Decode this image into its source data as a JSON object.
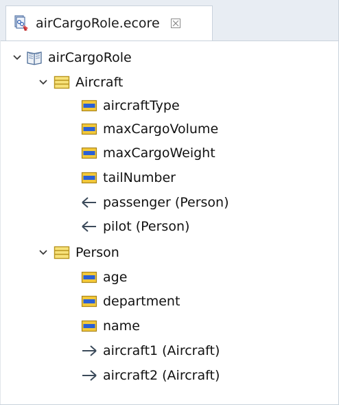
{
  "tab": {
    "title": "airCargoRole.ecore",
    "close_glyph": "⛝",
    "icon": "ecore-file-icon"
  },
  "tree": {
    "root": {
      "label": "airCargoRole",
      "icon": "package-icon",
      "expanded": true
    },
    "classes": [
      {
        "label": "Aircraft",
        "icon": "eclass-icon",
        "expanded": true,
        "children": [
          {
            "label": "aircraftType",
            "icon": "eattribute-icon"
          },
          {
            "label": "maxCargoVolume",
            "icon": "eattribute-icon"
          },
          {
            "label": "maxCargoWeight",
            "icon": "eattribute-icon"
          },
          {
            "label": "tailNumber",
            "icon": "eattribute-icon"
          },
          {
            "label": "passenger (Person)",
            "icon": "ereference-incoming-icon"
          },
          {
            "label": "pilot (Person)",
            "icon": "ereference-incoming-icon"
          }
        ]
      },
      {
        "label": "Person",
        "icon": "eclass-icon",
        "expanded": true,
        "children": [
          {
            "label": "age",
            "icon": "eattribute-icon"
          },
          {
            "label": "department",
            "icon": "eattribute-icon"
          },
          {
            "label": "name",
            "icon": "eattribute-icon"
          },
          {
            "label": "aircraft1 (Aircraft)",
            "icon": "ereference-outgoing-icon"
          },
          {
            "label": "aircraft2 (Aircraft)",
            "icon": "ereference-outgoing-icon"
          }
        ]
      }
    ]
  },
  "colors": {
    "tabbar_bg": "#e8edf3",
    "class_fill": "#f7e27a",
    "class_stroke": "#b8941e",
    "attr_blue": "#2a5fd6",
    "attr_yellow": "#f3c93a",
    "ref_stroke": "#3b4a5a"
  }
}
